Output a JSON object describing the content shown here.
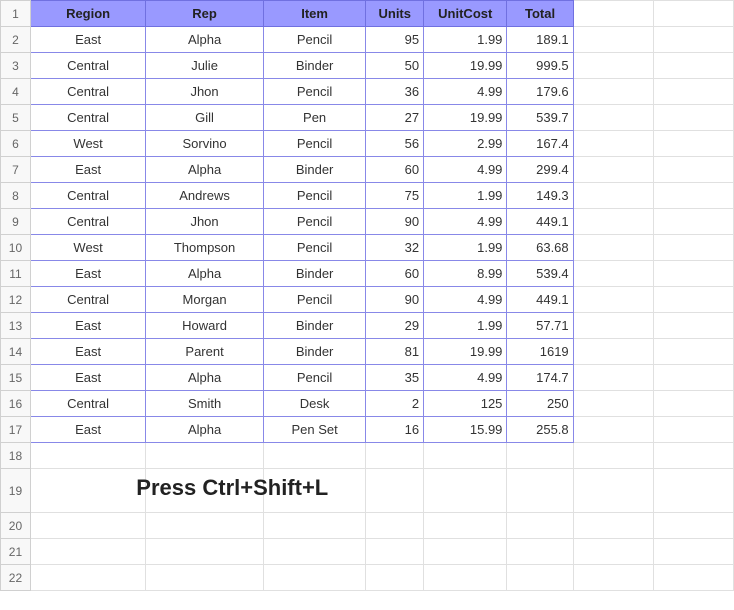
{
  "headers": {
    "region": "Region",
    "rep": "Rep",
    "item": "Item",
    "units": "Units",
    "unitcost": "UnitCost",
    "total": "Total"
  },
  "rows": [
    {
      "n": "1",
      "region": "",
      "rep": "",
      "item": "",
      "units": "",
      "unitcost": "",
      "total": ""
    },
    {
      "n": "2",
      "region": "East",
      "rep": "Alpha",
      "item": "Pencil",
      "units": "95",
      "unitcost": "1.99",
      "total": "189.1"
    },
    {
      "n": "3",
      "region": "Central",
      "rep": "Julie",
      "item": "Binder",
      "units": "50",
      "unitcost": "19.99",
      "total": "999.5"
    },
    {
      "n": "4",
      "region": "Central",
      "rep": "Jhon",
      "item": "Pencil",
      "units": "36",
      "unitcost": "4.99",
      "total": "179.6"
    },
    {
      "n": "5",
      "region": "Central",
      "rep": "Gill",
      "item": "Pen",
      "units": "27",
      "unitcost": "19.99",
      "total": "539.7"
    },
    {
      "n": "6",
      "region": "West",
      "rep": "Sorvino",
      "item": "Pencil",
      "units": "56",
      "unitcost": "2.99",
      "total": "167.4"
    },
    {
      "n": "7",
      "region": "East",
      "rep": "Alpha",
      "item": "Binder",
      "units": "60",
      "unitcost": "4.99",
      "total": "299.4"
    },
    {
      "n": "8",
      "region": "Central",
      "rep": "Andrews",
      "item": "Pencil",
      "units": "75",
      "unitcost": "1.99",
      "total": "149.3"
    },
    {
      "n": "9",
      "region": "Central",
      "rep": "Jhon",
      "item": "Pencil",
      "units": "90",
      "unitcost": "4.99",
      "total": "449.1"
    },
    {
      "n": "10",
      "region": "West",
      "rep": "Thompson",
      "item": "Pencil",
      "units": "32",
      "unitcost": "1.99",
      "total": "63.68"
    },
    {
      "n": "11",
      "region": "East",
      "rep": "Alpha",
      "item": "Binder",
      "units": "60",
      "unitcost": "8.99",
      "total": "539.4"
    },
    {
      "n": "12",
      "region": "Central",
      "rep": "Morgan",
      "item": "Pencil",
      "units": "90",
      "unitcost": "4.99",
      "total": "449.1"
    },
    {
      "n": "13",
      "region": "East",
      "rep": "Howard",
      "item": "Binder",
      "units": "29",
      "unitcost": "1.99",
      "total": "57.71"
    },
    {
      "n": "14",
      "region": "East",
      "rep": "Parent",
      "item": "Binder",
      "units": "81",
      "unitcost": "19.99",
      "total": "1619"
    },
    {
      "n": "15",
      "region": "East",
      "rep": "Alpha",
      "item": "Pencil",
      "units": "35",
      "unitcost": "4.99",
      "total": "174.7"
    },
    {
      "n": "16",
      "region": "Central",
      "rep": "Smith",
      "item": "Desk",
      "units": "2",
      "unitcost": "125",
      "total": "250"
    },
    {
      "n": "17",
      "region": "East",
      "rep": "Alpha",
      "item": "Pen Set",
      "units": "16",
      "unitcost": "15.99",
      "total": "255.8"
    }
  ],
  "emptyRows": [
    "18",
    "19",
    "20",
    "21",
    "22"
  ],
  "instruction": "Press Ctrl+Shift+L",
  "instructionRowStart": "19"
}
